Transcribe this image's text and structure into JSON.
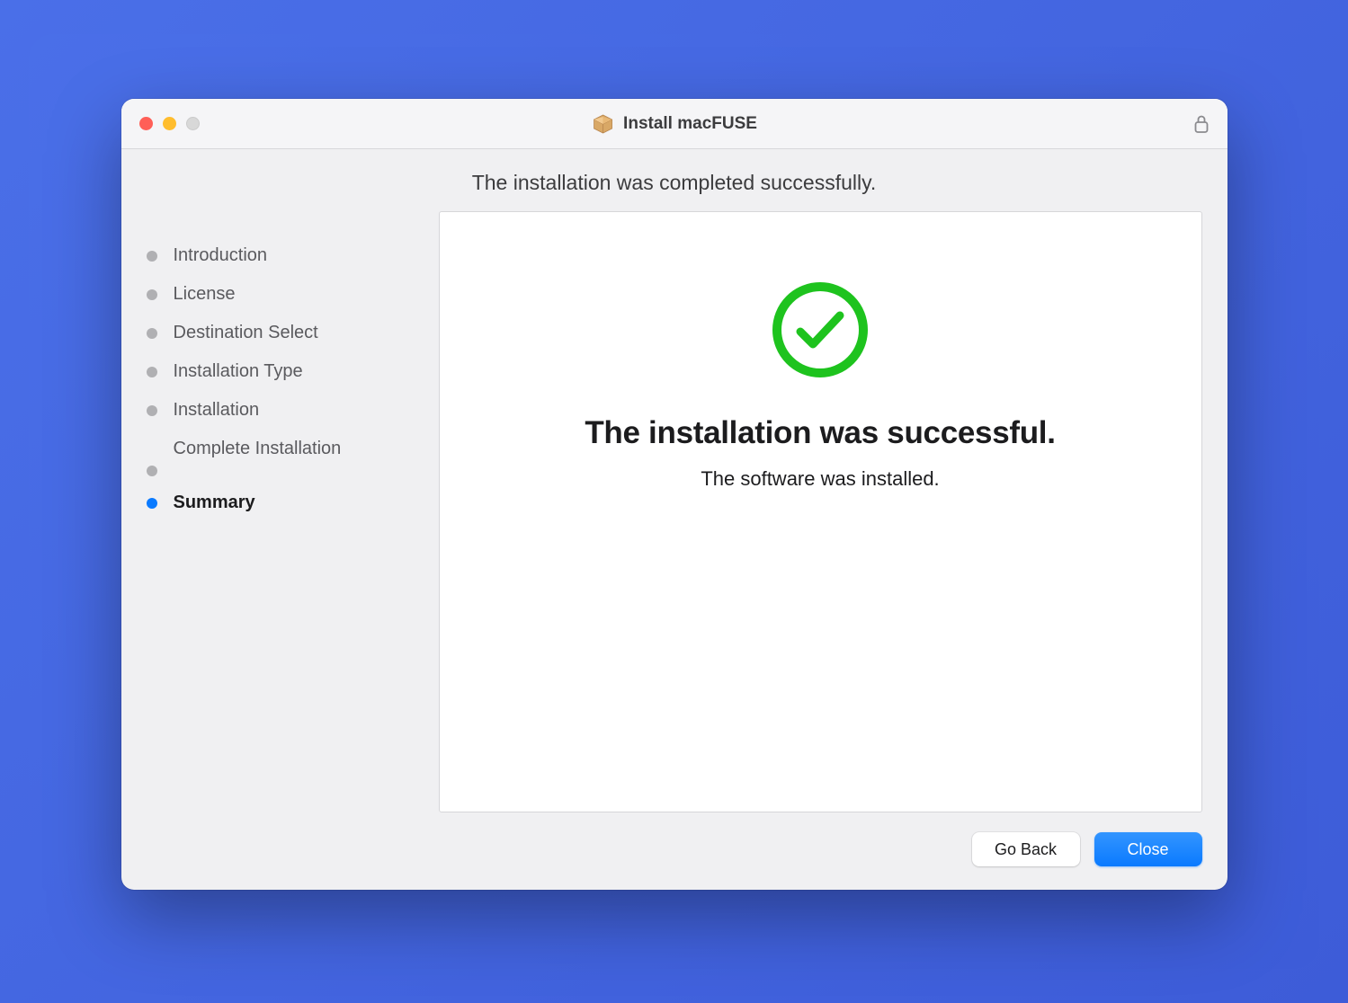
{
  "window": {
    "title": "Install macFUSE"
  },
  "heading": "The installation was completed successfully.",
  "sidebar": {
    "steps": [
      {
        "label": "Introduction",
        "active": false
      },
      {
        "label": "License",
        "active": false
      },
      {
        "label": "Destination Select",
        "active": false
      },
      {
        "label": "Installation Type",
        "active": false
      },
      {
        "label": "Installation",
        "active": false
      },
      {
        "label": "Complete Installation",
        "active": false
      },
      {
        "label": "Summary",
        "active": true
      }
    ]
  },
  "main": {
    "title": "The installation was successful.",
    "subtitle": "The software was installed."
  },
  "footer": {
    "back_label": "Go Back",
    "close_label": "Close"
  }
}
